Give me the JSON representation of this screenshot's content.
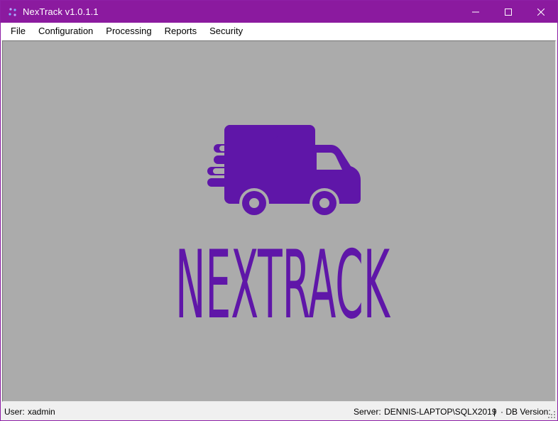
{
  "window": {
    "title": "NexTrack v1.0.1.1",
    "controls": [
      "minimize-icon",
      "maximize-icon",
      "close-icon"
    ]
  },
  "menu": {
    "items": [
      "File",
      "Configuration",
      "Processing",
      "Reports",
      "Security"
    ]
  },
  "logo": {
    "text": "NEXTRACK",
    "icon": "delivery-truck-icon",
    "color": "#5f16a8"
  },
  "status": {
    "user_label": "User:",
    "user_value": "xadmin",
    "server_label": "Server:",
    "server_value": "DENNIS-LAPTOP\\SQLX2019",
    "separator": "|",
    "db_label": "· DB Version:"
  },
  "colors": {
    "titlebar": "#8b1a9f",
    "client_bg": "#ababab",
    "brand": "#5f16a8"
  }
}
